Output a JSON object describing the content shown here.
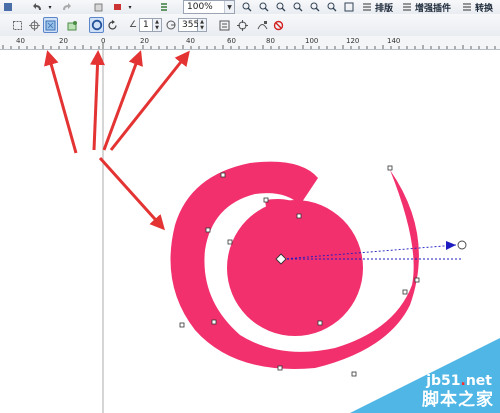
{
  "toolbar_top": {
    "zoom_value": "100%",
    "menu_layout": "排版",
    "menu_plugins": "增强插件",
    "menu_convert": "转换"
  },
  "toolbar_property": {
    "width_value": "1",
    "angle_value": "355"
  },
  "ruler": {
    "ticks": [
      "40",
      "20",
      "0",
      "20",
      "40",
      "60",
      "80",
      "100",
      "120",
      "140"
    ]
  },
  "watermark": {
    "site_prefix": "jb51",
    "site_dot": ".",
    "site_suffix": "net",
    "site_name": "脚本之家"
  },
  "colors": {
    "spiral": "#f2306e",
    "arrow": "#e33333",
    "guide": "#1c1cc0",
    "watermark_bg": "#4fb6e6",
    "toolbar_bg": "#eceff3"
  }
}
